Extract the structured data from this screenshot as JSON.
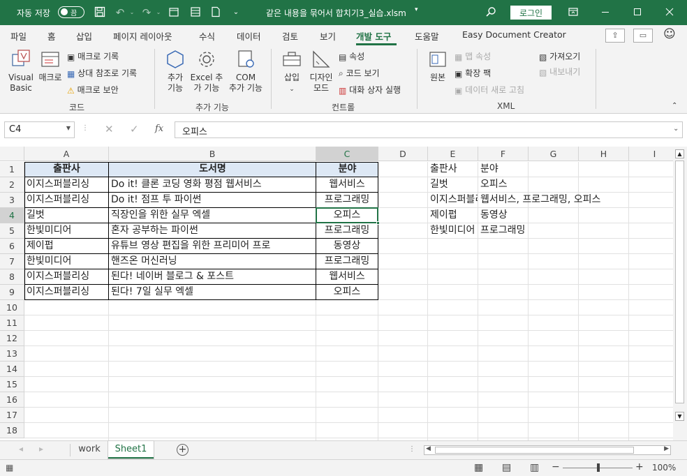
{
  "titlebar": {
    "autosave_label": "자동 저장",
    "autosave_state": "끔",
    "filename": "같은 내용을 묶어서 합치기3_실습.xlsm",
    "login_label": "로그인"
  },
  "tabs": [
    "파일",
    "홈",
    "삽입",
    "페이지 레이아웃",
    "수식",
    "데이터",
    "검토",
    "보기",
    "개발 도구",
    "도움말",
    "Easy Document Creator"
  ],
  "active_tab": "개발 도구",
  "ribbon": {
    "code": {
      "vb_label_1": "Visual",
      "vb_label_2": "Basic",
      "macro_label": "매크로",
      "record_macro": "매크로 기록",
      "relative_ref": "상대 참조로 기록",
      "macro_security": "매크로 보안",
      "group_label": "코드"
    },
    "addins": {
      "addin_1": "추가",
      "addin_2": "기능",
      "excel_addin_1": "Excel 추",
      "excel_addin_2": "가 기능",
      "com_addin_1": "COM",
      "com_addin_2": "추가 기능",
      "group_label": "추가 기능"
    },
    "controls": {
      "insert_1": "삽입",
      "design_1": "디자인",
      "design_2": "모드",
      "properties": "속성",
      "view_code": "코드 보기",
      "run_dialog": "대화 상자 실행",
      "group_label": "컨트롤"
    },
    "xml": {
      "source": "원본",
      "map_props": "맵 속성",
      "expansion_packs": "확장 팩",
      "refresh_data": "데이터 새로 고침",
      "import": "가져오기",
      "export": "내보내기",
      "group_label": "XML"
    }
  },
  "formula_bar": {
    "name_box": "C4",
    "formula": "오피스"
  },
  "columns": [
    "A",
    "B",
    "C",
    "D",
    "E",
    "F",
    "G",
    "H",
    "I"
  ],
  "rows": [
    "1",
    "2",
    "3",
    "4",
    "5",
    "6",
    "7",
    "8",
    "9",
    "10",
    "11",
    "12",
    "13",
    "14",
    "15",
    "16",
    "17",
    "18"
  ],
  "table": {
    "headers": [
      "출판사",
      "도서명",
      "분야"
    ],
    "rows": [
      [
        "이지스퍼블리싱",
        "Do it! 클론 코딩 영화 평점 웹서비스",
        "웹서비스"
      ],
      [
        "이지스퍼블리싱",
        "Do it! 점프 투 파이썬",
        "프로그래밍"
      ],
      [
        "길벗",
        "직장인을 위한 실무 엑셀",
        "오피스"
      ],
      [
        "한빛미디어",
        "혼자 공부하는 파이썬",
        "프로그래밍"
      ],
      [
        "제이펍",
        "유튜브 영상 편집을 위한 프리미어 프로",
        "동영상"
      ],
      [
        "한빛미디어",
        "핸즈온 머신러닝",
        "프로그래밍"
      ],
      [
        "이지스퍼블리싱",
        "된다! 네이버 블로그 & 포스트",
        "웹서비스"
      ],
      [
        "이지스퍼블리싱",
        "된다! 7일 실무 엑셀",
        "오피스"
      ]
    ]
  },
  "result": {
    "headers": [
      "출판사",
      "분야"
    ],
    "rows": [
      [
        "길벗",
        "오피스"
      ],
      [
        "이지스퍼블리싱",
        "웹서비스, 프로그래밍, 오피스"
      ],
      [
        "제이펍",
        "동영상"
      ],
      [
        "한빛미디어",
        "프로그래밍"
      ]
    ]
  },
  "sheets": [
    "work",
    "Sheet1"
  ],
  "active_sheet": "Sheet1",
  "zoom": "100%",
  "colors": {
    "excel_green": "#217346",
    "header_fill": "#dde8f5"
  }
}
